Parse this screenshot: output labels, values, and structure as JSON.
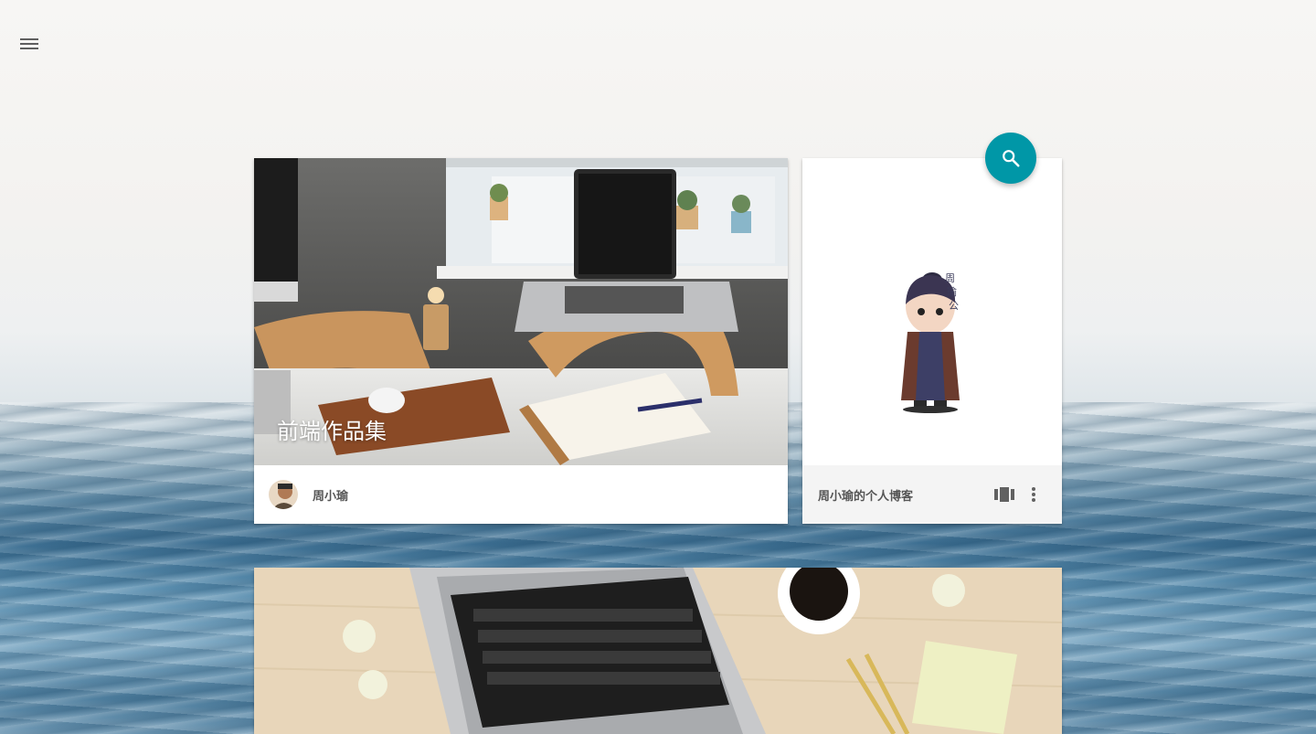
{
  "header": {
    "menu_icon": "menu-icon"
  },
  "fab": {
    "icon": "search-icon",
    "color": "#0097a7"
  },
  "cards": [
    {
      "title": "前端作品集",
      "author": "周小瑜"
    },
    {
      "title": "周小瑜的个人博客",
      "actions": [
        "view-carousel-icon",
        "more-vert-icon"
      ]
    },
    {
      "image": "laptop-desk-photo"
    }
  ]
}
